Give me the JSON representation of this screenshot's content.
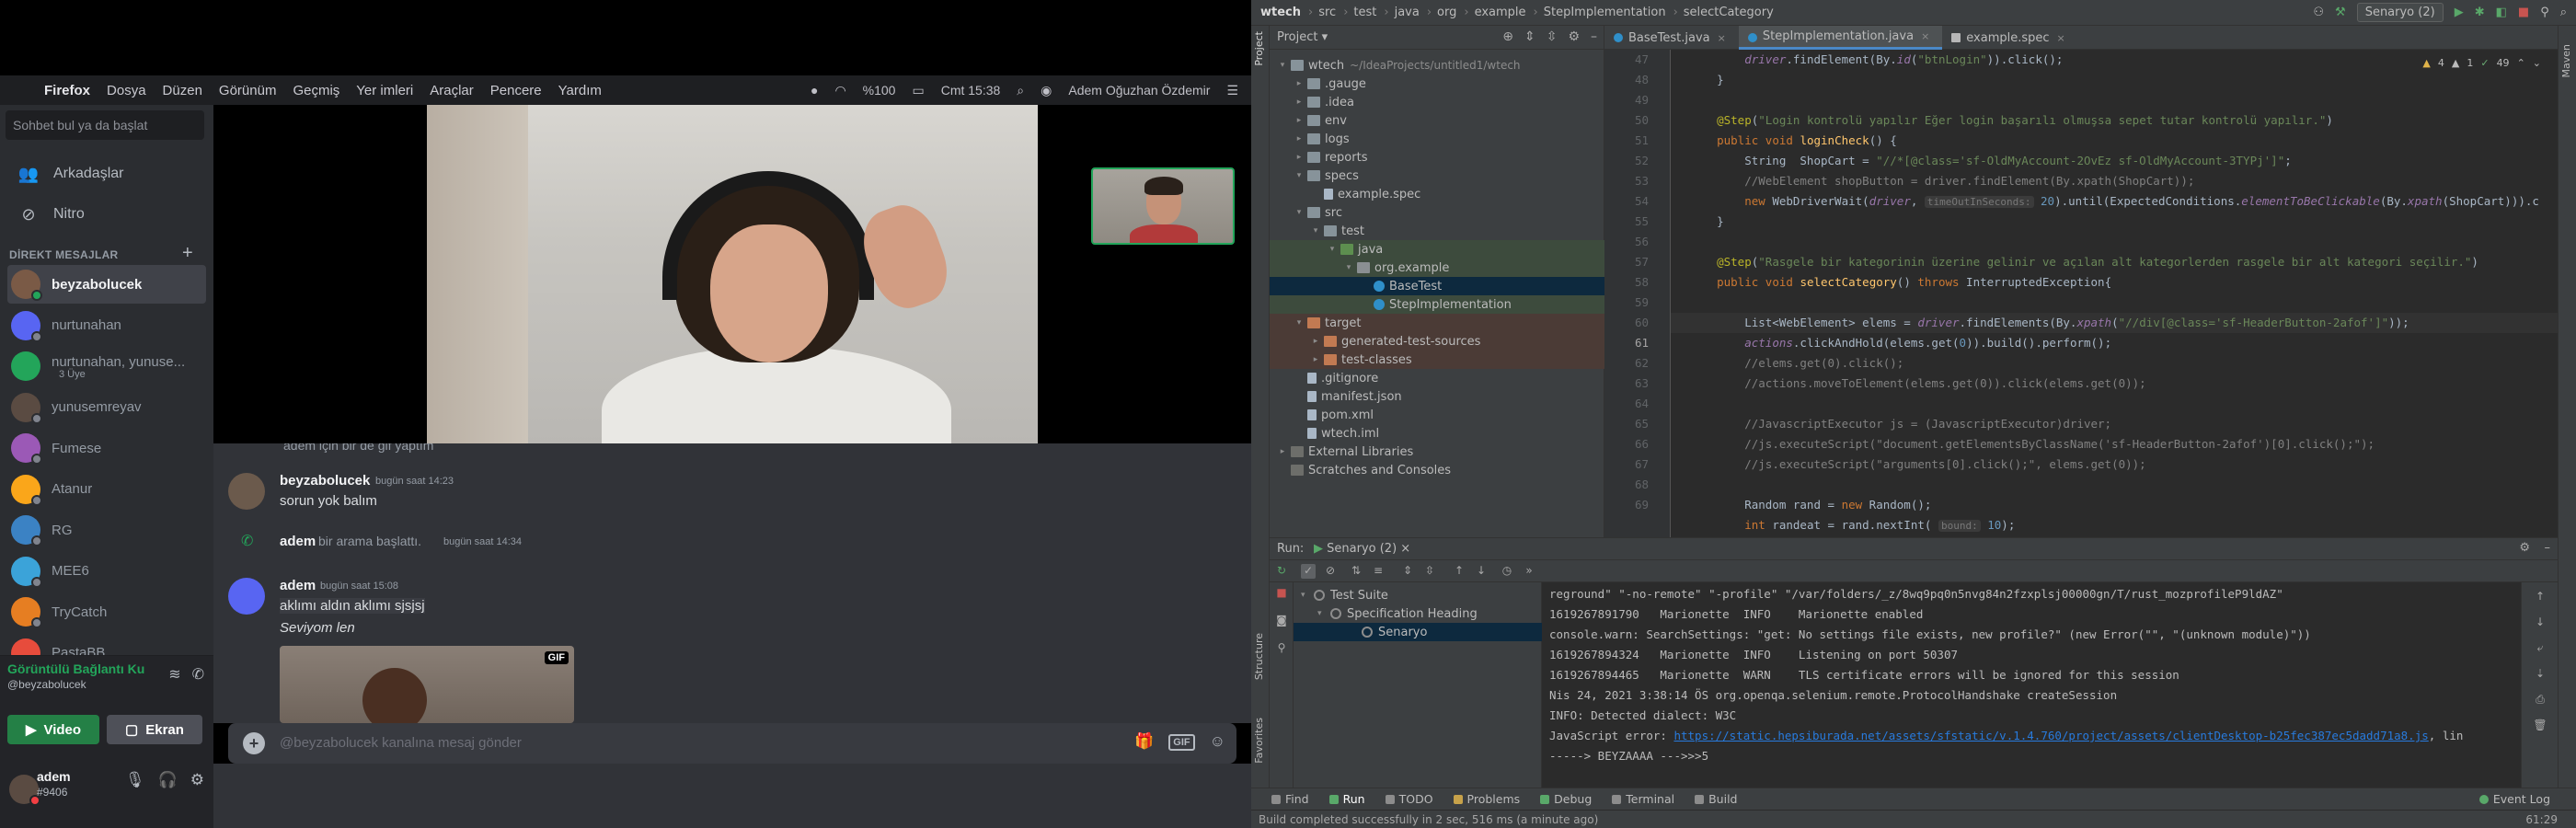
{
  "mac_menu": {
    "apple": "",
    "app": "Firefox",
    "items": [
      "Dosya",
      "Düzen",
      "Görünüm",
      "Geçmiş",
      "Yer imleri",
      "Araçlar",
      "Pencere",
      "Yardım"
    ],
    "battery": "%100",
    "clock": "Cmt 15:38",
    "user": "Adem Oğuzhan Özdemir"
  },
  "discord": {
    "search_placeholder": "Sohbet bul ya da başlat",
    "nav": [
      {
        "label": "Arkadaşlar",
        "icon": "👥"
      },
      {
        "label": "Nitro",
        "icon": "⊘"
      }
    ],
    "dm_header": "DİREKT MESAJLAR",
    "dm_add": "+",
    "dms": [
      {
        "name": "beyzabolucek",
        "color": "#7a5a46",
        "status": "#23a55a",
        "active": true
      },
      {
        "name": "nurtunahan",
        "color": "#5865f2",
        "status": "#80848e"
      },
      {
        "name": "nurtunahan, yunuse...",
        "color": "#23a55a",
        "sub": "3 Üye"
      },
      {
        "name": "yunusemreyav",
        "color": "#5a4b42",
        "status": "#80848e"
      },
      {
        "name": "Fumese",
        "color": "#9b59b6",
        "status": "#80848e"
      },
      {
        "name": "Atanur",
        "color": "#faa61a",
        "status": "#80848e"
      },
      {
        "name": "RG",
        "color": "#3b82c4",
        "status": "#80848e"
      },
      {
        "name": "MEE6",
        "color": "#3ba3d9",
        "status": "#80848e"
      },
      {
        "name": "TryCatch",
        "color": "#e67e22",
        "status": "#80848e"
      },
      {
        "name": "PastaBB",
        "color": "#e74c3c",
        "status": "#80848e"
      }
    ],
    "voice": {
      "status": "Görüntülü Bağlantı Ku",
      "user": "@beyzabolucek",
      "video_label": "Video",
      "screen_label": "Ekran"
    },
    "user": {
      "name": "adem",
      "tag": "#9406"
    },
    "messages": [
      {
        "name": "",
        "time": "",
        "text": "adem için bir de gif yaptım"
      },
      {
        "name": "beyzabolucek",
        "time": "bugün saat 14:23",
        "text": "sorun yok balım"
      },
      {
        "name": "adem",
        "time": "bugün saat 14:34",
        "text": "bir arama başlattı."
      },
      {
        "name": "adem",
        "time": "bugün saat 15:08",
        "text": "aklımı aldın aklımı sjsjsj",
        "text2": "Seviyom len"
      }
    ],
    "gif_badge": "GIF",
    "input_placeholder": "@beyzabolucek kanalına mesaj gönder",
    "input_gif": "GIF"
  },
  "ide": {
    "breadcrumbs": [
      "wtech",
      "src",
      "test",
      "java",
      "org",
      "example",
      "StepImplementation",
      "selectCategory"
    ],
    "run_config": "Senaryo (2)",
    "project_title": "Project",
    "tree": [
      {
        "label": "wtech",
        "dim": "~/IdeaProjects/untitled1/wtech",
        "icon": "folder",
        "indent": 0,
        "arrow": "▾"
      },
      {
        "label": ".gauge",
        "icon": "folder",
        "indent": 1,
        "arrow": "▸"
      },
      {
        "label": ".idea",
        "icon": "folder",
        "indent": 1,
        "arrow": "▸"
      },
      {
        "label": "env",
        "icon": "folder",
        "indent": 1,
        "arrow": "▸"
      },
      {
        "label": "logs",
        "icon": "folder",
        "indent": 1,
        "arrow": "▸"
      },
      {
        "label": "reports",
        "icon": "folder",
        "indent": 1,
        "arrow": "▸"
      },
      {
        "label": "specs",
        "icon": "folder",
        "indent": 1,
        "arrow": "▾"
      },
      {
        "label": "example.spec",
        "icon": "file",
        "indent": 2,
        "arrow": ""
      },
      {
        "label": "src",
        "icon": "folder",
        "indent": 1,
        "arrow": "▾"
      },
      {
        "label": "test",
        "icon": "folder",
        "indent": 2,
        "arrow": "▾"
      },
      {
        "label": "java",
        "icon": "folder-test",
        "indent": 3,
        "arrow": "▾",
        "hl": "green"
      },
      {
        "label": "org.example",
        "icon": "folder-pkg",
        "indent": 4,
        "arrow": "▾",
        "hl": "green"
      },
      {
        "label": "BaseTest",
        "icon": "java",
        "indent": 5,
        "arrow": "",
        "hl": "sel"
      },
      {
        "label": "StepImplementation",
        "icon": "java",
        "indent": 5,
        "arrow": "",
        "hl": "green"
      },
      {
        "label": "target",
        "icon": "folder-excl",
        "indent": 1,
        "arrow": "▾",
        "hl": "target"
      },
      {
        "label": "generated-test-sources",
        "icon": "folder-excl",
        "indent": 2,
        "arrow": "▸",
        "hl": "target"
      },
      {
        "label": "test-classes",
        "icon": "folder-excl",
        "indent": 2,
        "arrow": "▸",
        "hl": "target"
      },
      {
        "label": ".gitignore",
        "icon": "file",
        "indent": 1,
        "arrow": ""
      },
      {
        "label": "manifest.json",
        "icon": "file",
        "indent": 1,
        "arrow": ""
      },
      {
        "label": "pom.xml",
        "icon": "file",
        "indent": 1,
        "arrow": ""
      },
      {
        "label": "wtech.iml",
        "icon": "file",
        "indent": 1,
        "arrow": ""
      },
      {
        "label": "External Libraries",
        "icon": "lib",
        "indent": 0,
        "arrow": "▸"
      },
      {
        "label": "Scratches and Consoles",
        "icon": "lib",
        "indent": 0,
        "arrow": ""
      }
    ],
    "tabs": [
      {
        "label": "BaseTest.java",
        "type": "java"
      },
      {
        "label": "StepImplementation.java",
        "type": "java",
        "active": true
      },
      {
        "label": "example.spec",
        "type": "spec"
      }
    ],
    "inspections": {
      "warnings": "4",
      "weak": "1",
      "typos": "49"
    },
    "line_numbers": [
      "47",
      "48",
      "49",
      "50",
      "51",
      "52",
      "53",
      "54",
      "55",
      "56",
      "57",
      "58",
      "59",
      "60",
      "61",
      "62",
      "63",
      "64",
      "65",
      "66",
      "67",
      "68",
      "69"
    ],
    "current_line": "61",
    "run": {
      "label": "Run:",
      "tab": "Senaryo (2)",
      "tests": [
        {
          "label": "Test Suite",
          "indent": 0
        },
        {
          "label": "Specification Heading",
          "indent": 1
        },
        {
          "label": "Senaryo",
          "indent": 2,
          "sel": true
        }
      ],
      "console": [
        "reground\" \"-no-remote\" \"-profile\" \"/var/folders/_z/8wq9pq0n5nvg84n2fzxplsj00000gn/T/rust_mozprofileP9ldAZ\"",
        "1619267891790   Marionette  INFO    Marionette enabled",
        "console.warn: SearchSettings: \"get: No settings file exists, new profile?\" (new Error(\"\", \"(unknown module)\"))",
        "1619267894324   Marionette  INFO    Listening on port 50307",
        "1619267894465   Marionette  WARN    TLS certificate errors will be ignored for this session",
        "Nis 24, 2021 3:38:14 ÖS org.openqa.selenium.remote.ProtocolHandshake createSession",
        "INFO: Detected dialect: W3C",
        "-----> BEYZAAAA --->>>5"
      ],
      "js_error_prefix": "JavaScript error: ",
      "js_error_link": "https://static.hepsiburada.net/assets/sfstatic/v.1.4.760/project/assets/clientDesktop-b25fec387ec5dadd71a8.js",
      "js_error_suffix": ", lin"
    },
    "bottom_tabs": [
      "Find",
      "Run",
      "TODO",
      "Problems",
      "Debug",
      "Terminal",
      "Build"
    ],
    "event_log": "Event Log",
    "status_msg": "Build completed successfully in 2 sec, 516 ms (a minute ago)",
    "caret": "61:29",
    "side_tabs_left": [
      "Project",
      "Structure",
      "Favorites"
    ],
    "side_tabs_right": [
      "Maven"
    ]
  }
}
